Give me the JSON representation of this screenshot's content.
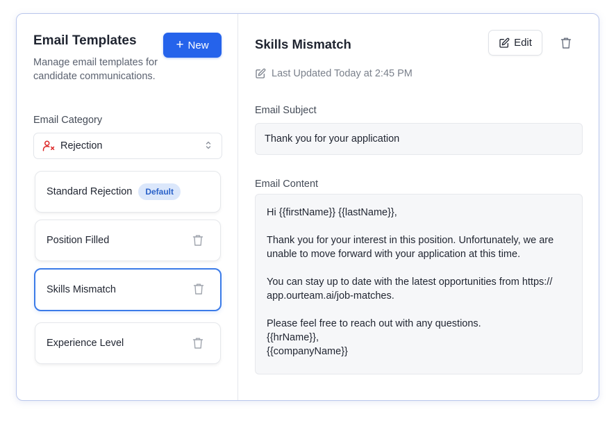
{
  "sidebar": {
    "title": "Email Templates",
    "description": "Manage email templates for candidate communications.",
    "new_button": {
      "icon": "plus-icon",
      "label": "New"
    },
    "category_label": "Email Category",
    "category_select": {
      "icon": "user-x-icon",
      "value": "Rejection"
    },
    "templates": [
      {
        "name": "Standard Rejection",
        "badge": "Default",
        "selected": false
      },
      {
        "name": "Position Filled",
        "selected": false
      },
      {
        "name": "Skills Mismatch",
        "selected": true
      },
      {
        "name": "Experience Level",
        "selected": false
      }
    ]
  },
  "detail": {
    "title": "Skills Mismatch",
    "edit_button": {
      "icon": "pencil-square-icon",
      "label": "Edit"
    },
    "delete_icon": "trash-icon",
    "last_updated": "Last Updated Today at 2:45 PM",
    "subject_label": "Email Subject",
    "subject_value": "Thank you for your application",
    "content_label": "Email Content",
    "content_lines": [
      "Hi {{firstName}} {{lastName}},",
      "",
      "Thank you for your interest in this position. Unfortunately, we are",
      "unable to move forward with your application at this time.",
      "",
      "You can stay up to date with the latest opportunities from https://",
      "app.ourteam.ai/job-matches.",
      "",
      "Please feel free to reach out with any questions.",
      "{{hrName}},",
      "{{companyName}}"
    ]
  },
  "colors": {
    "accent": "#2563eb",
    "badge_bg": "#dbe7fb",
    "badge_text": "#2b62c9",
    "reject_icon": "#dc2626",
    "selected_border": "#3b7be8"
  }
}
